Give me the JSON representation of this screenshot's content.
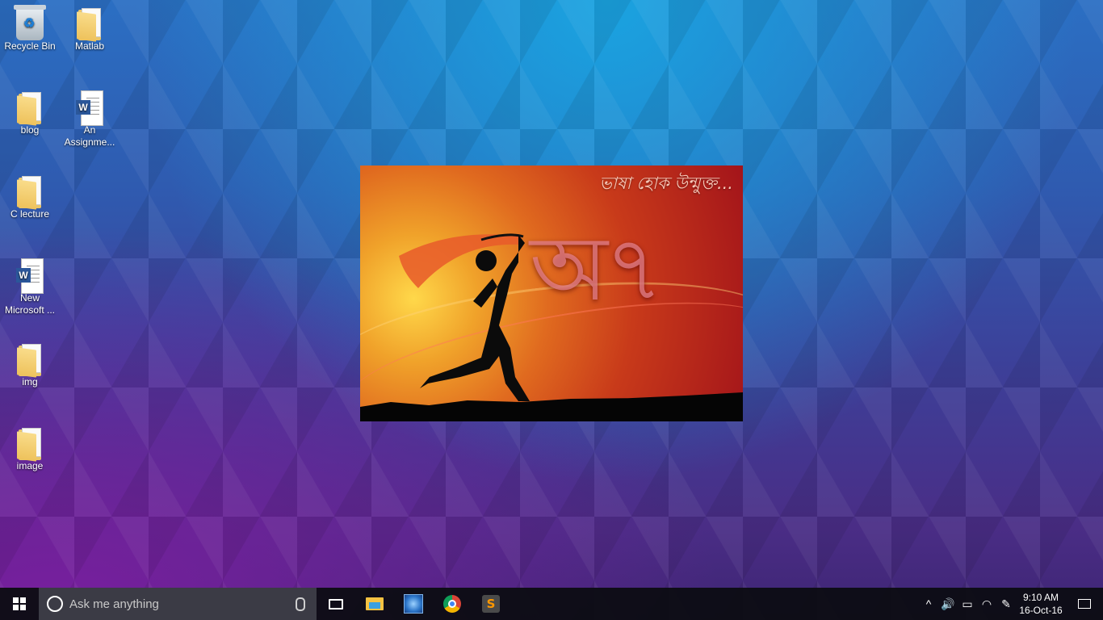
{
  "desktop_icons": [
    {
      "label": "Recycle Bin",
      "icon": "recycle-bin-icon"
    },
    {
      "label": "Matlab",
      "icon": "folder-icon"
    },
    {
      "label": "blog",
      "icon": "folder-icon"
    },
    {
      "label": "An Assignme...",
      "icon": "word-document-icon"
    },
    {
      "label": "C lecture",
      "icon": "folder-icon"
    },
    {
      "label": "New Microsoft ...",
      "icon": "word-document-icon"
    },
    {
      "label": "img",
      "icon": "folder-icon"
    },
    {
      "label": "image",
      "icon": "folder-icon"
    }
  ],
  "wallpaper": {
    "caption": "ভাষা হোক উন্মুক্ত...",
    "big_text": "অ৭"
  },
  "taskbar": {
    "search_placeholder": "Ask me anything",
    "apps": [
      "task-view",
      "file-explorer",
      "matlab",
      "chrome",
      "sublime-text"
    ],
    "sublime_letter": "S",
    "clock_time": "9:10 AM",
    "clock_date": "16-Oct-16"
  },
  "tray": {
    "chevron": "^",
    "volume": "🔊",
    "battery": "▭",
    "wifi": "◠",
    "pen": "✎"
  }
}
